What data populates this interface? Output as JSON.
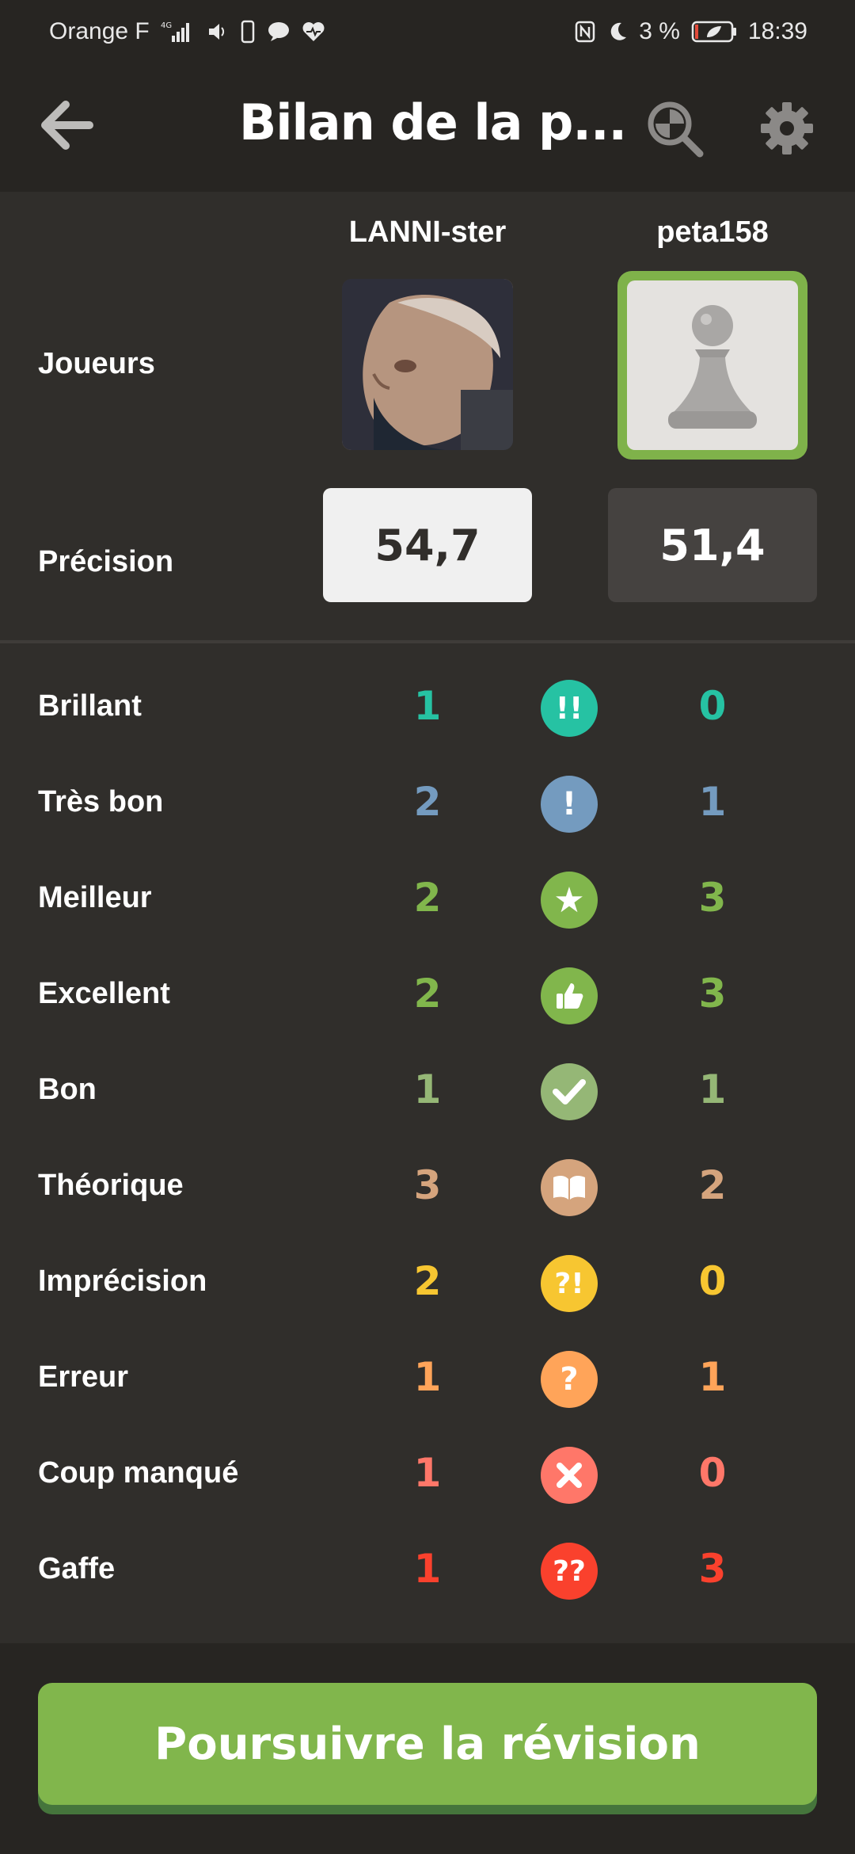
{
  "status_bar": {
    "carrier": "Orange F",
    "network": "4G",
    "battery_percent": "3 %",
    "time": "18:39"
  },
  "header": {
    "title": "Bilan de la p...",
    "icons": [
      "back-arrow-icon",
      "analysis-magnifier-icon",
      "gear-icon"
    ]
  },
  "players": {
    "label": "Joueurs",
    "white": {
      "name": "LANNI-ster",
      "avatar": "photo"
    },
    "black": {
      "name": "peta158",
      "avatar": "pawn-icon"
    }
  },
  "accuracy": {
    "label": "Précision",
    "white": "54,7",
    "black": "51,4"
  },
  "moves": [
    {
      "label": "Brillant",
      "white": "1",
      "black": "0",
      "symbol": "!!",
      "icon": "brilliant-icon",
      "color": "#26c2a3"
    },
    {
      "label": "Très bon",
      "white": "2",
      "black": "1",
      "symbol": "!",
      "icon": "great-icon",
      "color": "#749bbf"
    },
    {
      "label": "Meilleur",
      "white": "2",
      "black": "3",
      "symbol": "★",
      "icon": "star-icon",
      "color": "#81b64c"
    },
    {
      "label": "Excellent",
      "white": "2",
      "black": "3",
      "symbol": "👍",
      "icon": "thumbs-up-icon",
      "color": "#81b64c"
    },
    {
      "label": "Bon",
      "white": "1",
      "black": "1",
      "symbol": "✔",
      "icon": "check-icon",
      "color": "#95b776"
    },
    {
      "label": "Théorique",
      "white": "3",
      "black": "2",
      "symbol": "📖",
      "icon": "book-icon",
      "color": "#d5a47d"
    },
    {
      "label": "Imprécision",
      "white": "2",
      "black": "0",
      "symbol": "?!",
      "icon": "inaccuracy-icon",
      "color": "#f7c631"
    },
    {
      "label": "Erreur",
      "white": "1",
      "black": "1",
      "symbol": "?",
      "icon": "mistake-icon",
      "color": "#ffa459"
    },
    {
      "label": "Coup manqué",
      "white": "1",
      "black": "0",
      "symbol": "✕",
      "icon": "miss-icon",
      "color": "#ff7769"
    },
    {
      "label": "Gaffe",
      "white": "1",
      "black": "3",
      "symbol": "??",
      "icon": "blunder-icon",
      "color": "#fa412d"
    }
  ],
  "footer": {
    "continue_label": "Poursuivre la révision",
    "accent": "#81b64c"
  }
}
